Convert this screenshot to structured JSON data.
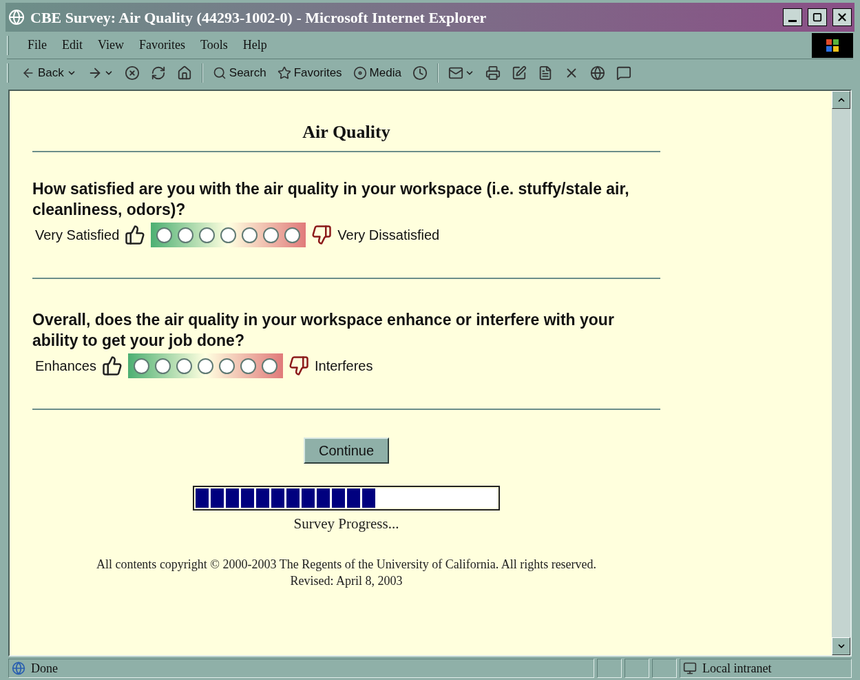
{
  "window": {
    "title": "CBE Survey: Air Quality (44293-1002-0) - Microsoft Internet Explorer"
  },
  "menu": [
    "File",
    "Edit",
    "View",
    "Favorites",
    "Tools",
    "Help"
  ],
  "toolbar": [
    {
      "kind": "text",
      "label": "Back"
    },
    {
      "kind": "icon"
    },
    {
      "kind": "icon"
    },
    {
      "kind": "icon"
    },
    {
      "kind": "icon"
    },
    {
      "kind": "separator"
    },
    {
      "kind": "text",
      "label": "Search"
    },
    {
      "kind": "text",
      "label": "Favorites"
    },
    {
      "kind": "text",
      "label": "Media"
    },
    {
      "kind": "icon"
    },
    {
      "kind": "separator"
    },
    {
      "kind": "icon"
    },
    {
      "kind": "icon"
    },
    {
      "kind": "icon"
    },
    {
      "kind": "icon"
    },
    {
      "kind": "icon"
    },
    {
      "kind": "icon"
    },
    {
      "kind": "icon"
    }
  ],
  "page": {
    "heading": "Air Quality",
    "questions": [
      {
        "text": "How satisfied are you with the air quality in your workspace (i.e. stuffy/stale air, cleanliness, odors)?",
        "low_label": "Very Satisfied",
        "high_label": "Very Dissatisfied",
        "options": [
          {
            "selected": false
          },
          {
            "selected": false
          },
          {
            "selected": false
          },
          {
            "selected": false
          },
          {
            "selected": false
          },
          {
            "selected": false
          },
          {
            "selected": false
          }
        ]
      },
      {
        "text": "Overall, does the air quality in your workspace enhance or interfere with your ability to get your job done?",
        "low_label": "Enhances",
        "high_label": "Interferes",
        "options": [
          {
            "selected": false
          },
          {
            "selected": false
          },
          {
            "selected": false
          },
          {
            "selected": false
          },
          {
            "selected": false
          },
          {
            "selected": false
          },
          {
            "selected": false
          }
        ]
      }
    ],
    "continue_button": "Continue",
    "progress": {
      "level": 0.6,
      "label": "Survey Progress..."
    },
    "footer": [
      "All contents copyright © 2000-2003 The Regents of the University of California. All rights reserved.",
      "Revised: April 8, 2003"
    ]
  },
  "status_bar": {
    "text": "Done",
    "zone": "Local intranet"
  }
}
